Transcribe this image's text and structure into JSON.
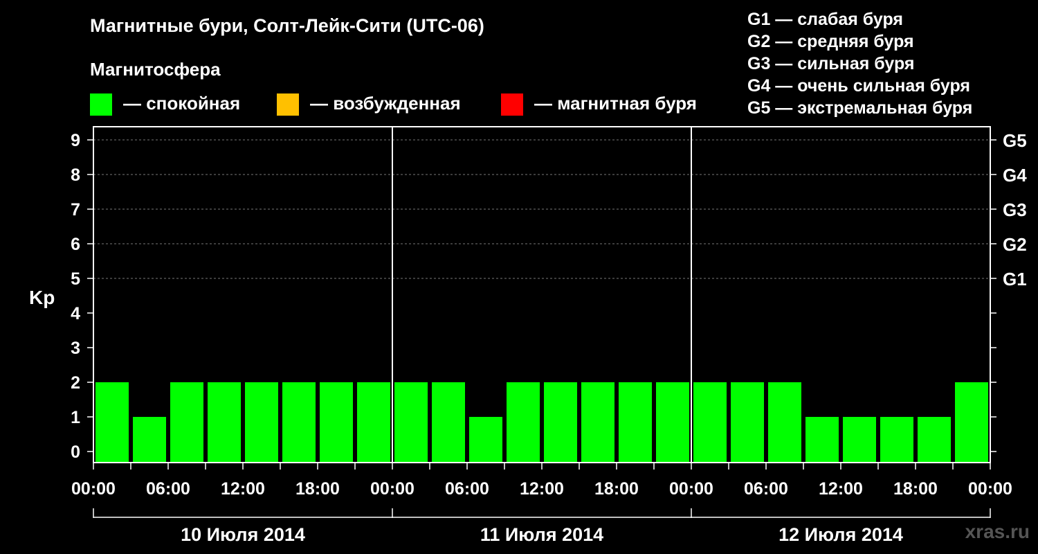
{
  "title": "Магнитные бури, Солт-Лейк-Сити (UTC-06)",
  "subtitle": "Магнитосфера",
  "legend": [
    {
      "color": "#00ff00",
      "label": "— спокойная"
    },
    {
      "color": "#ffc000",
      "label": "— возбужденная"
    },
    {
      "color": "#ff0000",
      "label": "— магнитная буря"
    }
  ],
  "g_legend": [
    "G1 — слабая буря",
    "G2 — средняя буря",
    "G3 — сильная буря",
    "G4 — очень сильная буря",
    "G5 — экстремальная буря"
  ],
  "watermark": "xras.ru",
  "chart_data": {
    "type": "bar",
    "ylabel": "Kp",
    "ylim": [
      0,
      9
    ],
    "yticks": [
      "0",
      "1",
      "2",
      "3",
      "4",
      "5",
      "6",
      "7",
      "8",
      "9"
    ],
    "right_ticks": [
      {
        "value": 5,
        "label": "G1"
      },
      {
        "value": 6,
        "label": "G2"
      },
      {
        "value": 7,
        "label": "G3"
      },
      {
        "value": 8,
        "label": "G4"
      },
      {
        "value": 9,
        "label": "G5"
      }
    ],
    "xtick_labels": [
      "00:00",
      "06:00",
      "12:00",
      "18:00",
      "00:00",
      "06:00",
      "12:00",
      "18:00",
      "00:00",
      "06:00",
      "12:00",
      "18:00",
      "00:00"
    ],
    "days": [
      "10 Июля 2014",
      "11 Июля 2014",
      "12 Июля 2014"
    ],
    "grid": "dashed at Kp 5–9",
    "series": [
      {
        "values": [
          2,
          1,
          2,
          2,
          2,
          2,
          2,
          2,
          2,
          2,
          1,
          2,
          2,
          2,
          2,
          2,
          2,
          2,
          2,
          1,
          1,
          1,
          1,
          2
        ],
        "color": "#00ff00"
      }
    ]
  }
}
